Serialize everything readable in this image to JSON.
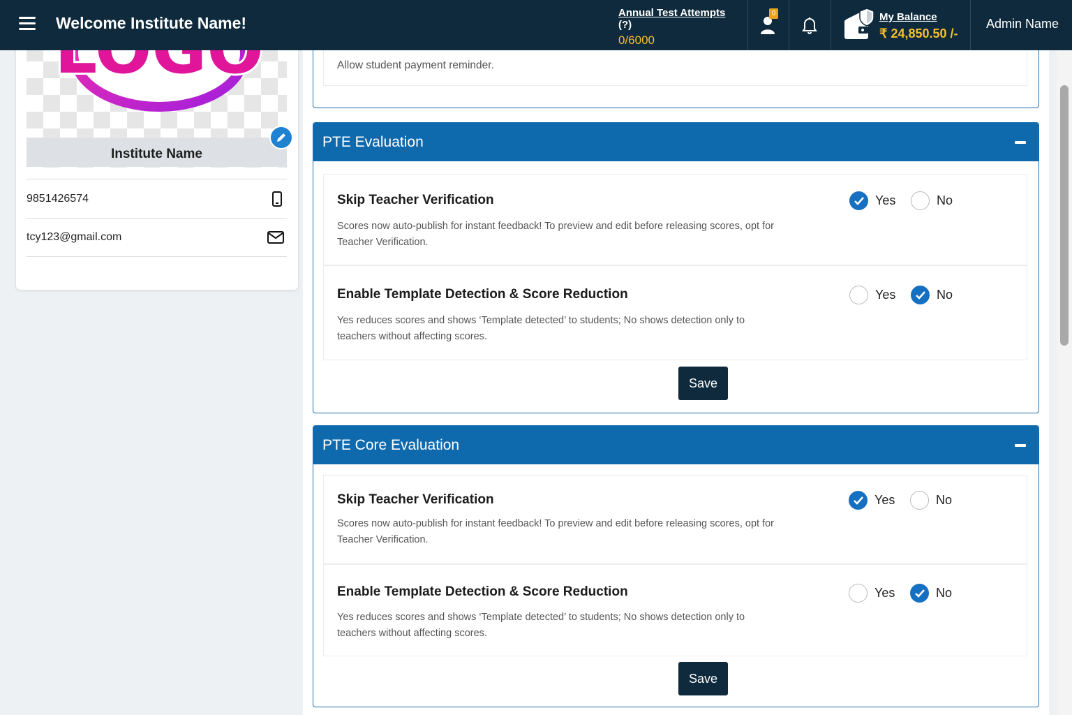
{
  "header": {
    "welcome": "Welcome Institute Name!",
    "attempts_label": "Annual Test Attempts",
    "attempts_help": " (?)",
    "attempts_value": "0/6000",
    "attempts_progress": 0,
    "profile_badge": "0",
    "balance_label": "My Balance",
    "balance_value": "₹ 24,850.50 /-",
    "admin_name": "Admin Name"
  },
  "profile": {
    "logo_text": "LOGO",
    "institute_name": "Institute Name",
    "phone": "9851426574",
    "email": "tcy123@gmail.com"
  },
  "top_partial": {
    "text": "Allow student payment reminder."
  },
  "pte_evaluation": {
    "title": "PTE Evaluation",
    "settings": [
      {
        "title": "Skip Teacher Verification",
        "description": "Scores now auto-publish for instant feedback! To preview and edit before releasing scores, opt for Teacher Verification.",
        "yes_label": "Yes",
        "no_label": "No",
        "selected": "yes"
      },
      {
        "title": "Enable Template Detection & Score Reduction",
        "description": "Yes reduces scores and shows ‘Template detected’ to students; No shows detection only to teachers without affecting scores.",
        "yes_label": "Yes",
        "no_label": "No",
        "selected": "no"
      }
    ],
    "save_label": "Save"
  },
  "pte_core_evaluation": {
    "title": "PTE Core Evaluation",
    "settings": [
      {
        "title": "Skip Teacher Verification",
        "description": "Scores now auto-publish for instant feedback! To preview and edit before releasing scores, opt for Teacher Verification.",
        "yes_label": "Yes",
        "no_label": "No",
        "selected": "yes"
      },
      {
        "title": "Enable Template Detection & Score Reduction",
        "description": "Yes reduces scores and shows ‘Template detected’ to students; No shows detection only to teachers without affecting scores.",
        "yes_label": "Yes",
        "no_label": "No",
        "selected": "no"
      }
    ],
    "save_label": "Save"
  },
  "colors": {
    "topbar": "#0e2a3c",
    "section_header": "#0f69ad",
    "accent_yellow": "#f6c02a",
    "radio_checked": "#1670c2"
  }
}
